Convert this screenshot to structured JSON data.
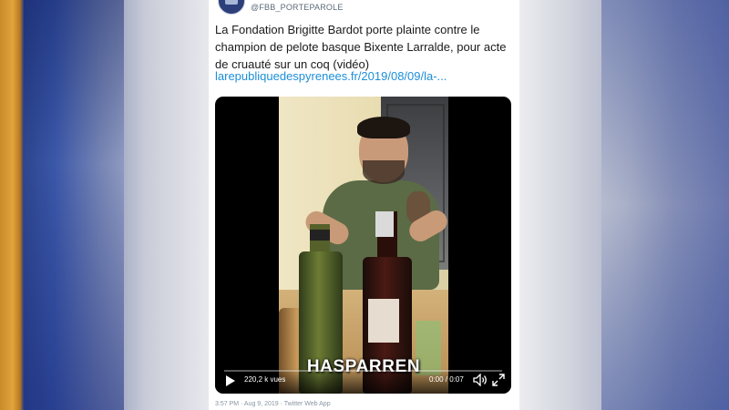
{
  "account": {
    "handle": "@FBB_PORTEPAROLE",
    "name_fragment": "...........",
    "avatar_icon": "fbb-logo-icon"
  },
  "tweet": {
    "text": "La Fondation Brigitte Bardot porte plainte contre le champion de pelote basque Bixente Larralde, pour acte de cruauté sur un coq (vidéo)",
    "link": "larepubliquedespyrenees.fr/2019/08/09/la-...",
    "footer": "3:57 PM · Aug 9, 2019 · Twitter Web App"
  },
  "video": {
    "caption": "HASPARREN",
    "views": "220,2 k vues",
    "time": "0:00 / 0:07",
    "progress_fraction": 0,
    "icons": [
      "play-icon",
      "volume-icon",
      "fullscreen-icon"
    ]
  },
  "colors": {
    "link": "#1d8fd8",
    "background": "#1e3c8c"
  }
}
